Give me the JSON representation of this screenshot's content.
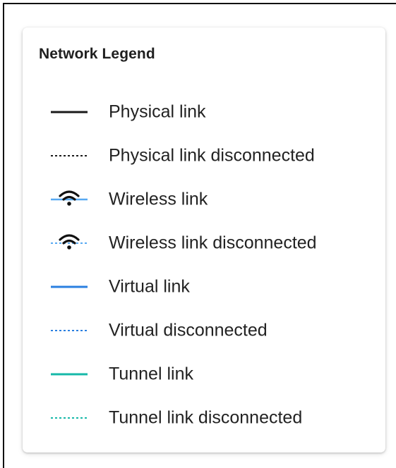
{
  "legend": {
    "title": "Network Legend",
    "items": [
      {
        "label": "Physical link",
        "icon": "solid-line-icon",
        "color": "#1a1a1a"
      },
      {
        "label": "Physical link disconnected",
        "icon": "dotted-line-icon",
        "color": "#1a1a1a"
      },
      {
        "label": "Wireless link",
        "icon": "wifi-solid-line-icon",
        "color": "#57a9f2"
      },
      {
        "label": "Wireless link disconnected",
        "icon": "wifi-dotted-line-icon",
        "color": "#57a9f2"
      },
      {
        "label": "Virtual link",
        "icon": "solid-line-icon",
        "color": "#2a7fe0"
      },
      {
        "label": "Virtual disconnected",
        "icon": "dotted-line-icon",
        "color": "#2a7fe0"
      },
      {
        "label": "Tunnel link",
        "icon": "solid-line-icon",
        "color": "#16b8a8"
      },
      {
        "label": "Tunnel link disconnected",
        "icon": "dotted-line-icon",
        "color": "#16b8a8"
      }
    ]
  }
}
